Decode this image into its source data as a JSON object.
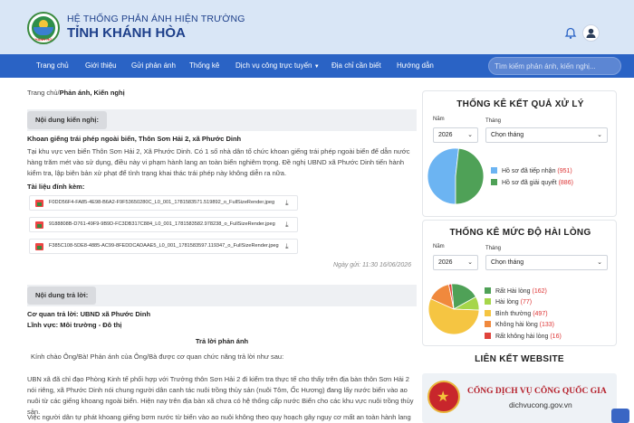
{
  "header": {
    "subtitle": "HỆ THỐNG PHẢN ÁNH HIỆN TRƯỜNG",
    "title": "TỈNH KHÁNH HÒA",
    "logo_text": "KHÁNH HÒA"
  },
  "nav": {
    "items": [
      "Trang chủ",
      "Giới thiệu",
      "Gửi phản ánh",
      "Thống kê",
      "Dịch vụ công trực tuyến",
      "Địa chỉ cần biết",
      "Hướng dẫn"
    ],
    "search_placeholder": "Tìm kiếm phản ánh, kiến nghị..."
  },
  "breadcrumb": {
    "home": "Trang chủ",
    "sep": "/",
    "current": "Phản ánh, Kiến nghị"
  },
  "petition": {
    "tag": "Nội dung kiến nghị:",
    "title": "Khoan giếng trái phép ngoài biển, Thôn Sơn Hải 2, xã Phước Dinh",
    "body": "Tại khu vực ven biển Thôn Sơn Hải 2, Xã Phước Dinh. Có 1 số nhà dân tổ chức khoan giếng trái phép ngoài biển để dẫn nước hàng trăm mét vào sử dụng, điều này vi phạm hành lang an toàn biển nghiêm trọng. Đề nghị UBND xã Phước Dinh tiến hành kiểm tra, lập biên bản xử phạt để tình trạng khai thác trái phép này không diễn ra nữa.",
    "attachments_label": "Tài liệu đính kèm:",
    "files": [
      "F0DD56F4-FA85-4E98-B6A2-F9F53650280C_L0_001_1781583571.519892_o_FullSizeRender.jpeg",
      "9188808B-D761-49F9-9B9D-FC3DB317C884_L0_001_1781583582.978238_o_FullSizeRender.jpeg",
      "F385C108-5DE8-4885-AC99-8FEDDCADAAE5_L0_001_1781583597.119347_o_FullSizeRender.jpeg"
    ],
    "sent_date": "Ngày gửi: 11:30 16/06/2026"
  },
  "reply": {
    "tag": "Nội dung trả lời:",
    "agency": "Cơ quan trả lời: UBND xã Phước Dinh",
    "field": "Lĩnh vực: Môi trường - Đô thị",
    "heading": "Trả lời phản ánh",
    "greeting": "Kính chào Ông/Bà! Phản ánh của Ông/Bà được cơ quan chức năng trả lời như sau:",
    "body": "UBN xã đã chỉ đạo Phòng Kinh tế phối hợp với Trưởng thôn Sơn Hải 2 đi kiểm tra thực tế cho thấy trên địa bàn thôn Sơn Hải 2 nói riêng, xã Phước Dinh nói chung người dân canh tác nuôi trồng thủy sản (nuôi Tôm, Ốc Hương) đang lấy nước biển vào ao nuôi từ các giếng khoang ngoài biển. Hiện nay trên địa bàn xã chưa có hệ thống cấp nước Biển cho các khu vực nuôi trồng thủy sản.",
    "body2": "Việc người dân tự phát khoang giếng bơm nước từ biển vào ao nuôi không theo quy hoạch gây nguy cơ mất an toàn hành lang"
  },
  "stats_result": {
    "title": "THỐNG KÊ KẾT QUẢ XỬ LÝ",
    "year_label": "Năm",
    "year_value": "2026",
    "month_label": "Tháng",
    "month_value": "Chọn tháng",
    "legend": [
      {
        "label": "Hồ sơ đã tiếp nhận",
        "count": "(951)",
        "color": "#6cb4f2"
      },
      {
        "label": "Hồ sơ đã giải quyết",
        "count": "(886)",
        "color": "#4fa157"
      }
    ]
  },
  "stats_satisfaction": {
    "title": "THỐNG KÊ MỨC ĐỘ HÀI LÒNG",
    "year_label": "Năm",
    "year_value": "2026",
    "month_label": "Tháng",
    "month_value": "Chọn tháng",
    "legend": [
      {
        "label": "Rất Hài lòng",
        "count": "(162)",
        "color": "#4fa157"
      },
      {
        "label": "Hài lòng",
        "count": "(77)",
        "color": "#a6d64a"
      },
      {
        "label": "Bình thường",
        "count": "(497)",
        "color": "#f5c542"
      },
      {
        "label": "Không hài lòng",
        "count": "(133)",
        "color": "#f0893d"
      },
      {
        "label": "Rất không hài lòng",
        "count": "(16)",
        "color": "#e0433b"
      }
    ]
  },
  "chart_data": [
    {
      "type": "pie",
      "categories": [
        "Hồ sơ đã tiếp nhận",
        "Hồ sơ đã giải quyết"
      ],
      "values": [
        951,
        886
      ]
    },
    {
      "type": "pie",
      "categories": [
        "Rất Hài lòng",
        "Hài lòng",
        "Bình thường",
        "Không hài lòng",
        "Rất không hài lòng"
      ],
      "values": [
        162,
        77,
        497,
        133,
        16
      ]
    }
  ],
  "links": {
    "title": "LIÊN KẾT WEBSITE",
    "banner_title": "CỔNG DỊCH VỤ CÔNG QUỐC GIA",
    "banner_url": "dichvucong.gov.vn"
  }
}
